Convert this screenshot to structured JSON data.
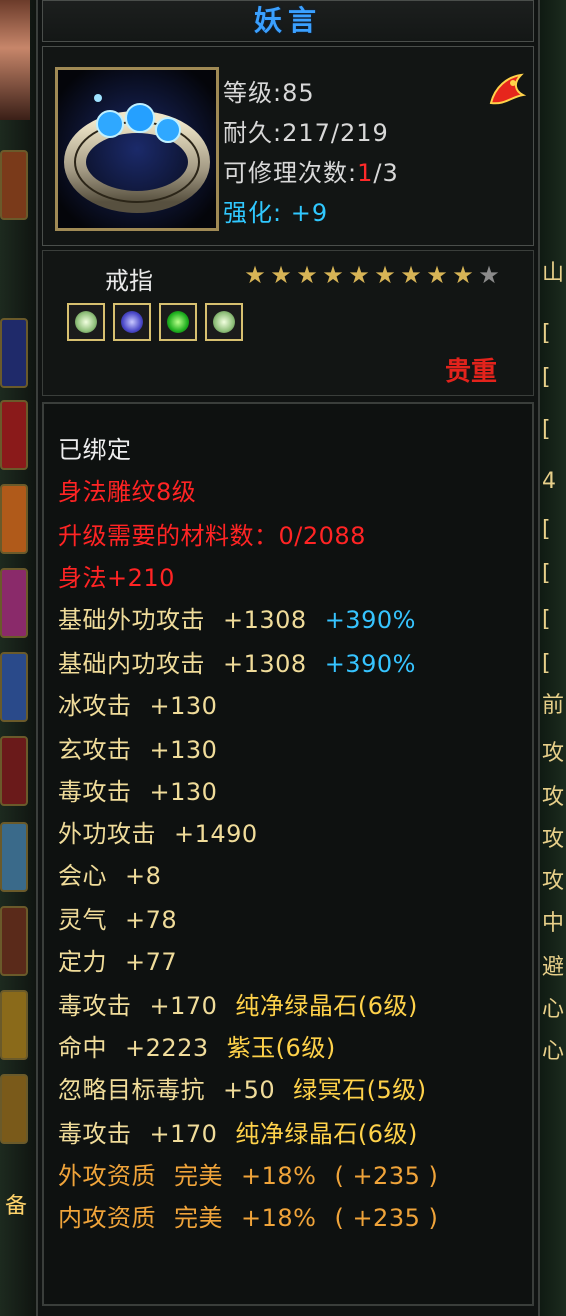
{
  "item": {
    "name": "妖言",
    "level": "等级:85",
    "durability_label": "耐久:",
    "durability_value": "217/219",
    "repairs_label": "可修理次数:",
    "repairs_used": "1",
    "repairs_total": "/3",
    "enhance_label": "强化:",
    "enhance_value": "+9",
    "type": "戒指",
    "stars_filled": 9,
    "stars_total": 10,
    "rarity": "贵重",
    "gems": [
      "white-gem",
      "blue-gem",
      "green-gem",
      "white-gem"
    ],
    "icon": "ring-icon",
    "badge_icon": "dragon-badge-icon"
  },
  "attributes": {
    "bound": "已绑定",
    "carve": "身法雕纹8级",
    "upgrade_materials": "升级需要的材料数：0/2088",
    "shenfa": "身法+210",
    "base_ext_attack": {
      "label": "基础外功攻击",
      "value": "+1308",
      "percent": "+390%"
    },
    "base_int_attack": {
      "label": "基础内功攻击",
      "value": "+1308",
      "percent": "+390%"
    },
    "ice_attack": {
      "label": "冰攻击",
      "value": "+130"
    },
    "mystic_attack": {
      "label": "玄攻击",
      "value": "+130"
    },
    "poison_attack": {
      "label": "毒攻击",
      "value": "+130"
    },
    "ext_attack": {
      "label": "外功攻击",
      "value": "+1490"
    },
    "crit": {
      "label": "会心",
      "value": "+8"
    },
    "spirit": {
      "label": "灵气",
      "value": "+78"
    },
    "resolve": {
      "label": "定力",
      "value": "+77"
    },
    "gem_line_1": {
      "label": "毒攻击",
      "value": "+170",
      "gem": "纯净绿晶石(6级)"
    },
    "gem_line_2": {
      "label": "命中",
      "value": "+2223",
      "gem": "紫玉(6级)"
    },
    "gem_line_3": {
      "label": "忽略目标毒抗",
      "value": "+50",
      "gem": "绿冥石(5级)"
    },
    "gem_line_4": {
      "label": "毒攻击",
      "value": "+170",
      "gem": "纯净绿晶石(6级)"
    },
    "aptitude_ext": {
      "label": "外攻资质",
      "grade": "完美",
      "percent": "+18%",
      "bonus": "( +235 )"
    },
    "aptitude_int": {
      "label": "内攻资质",
      "grade": "完美",
      "percent": "+18%",
      "bonus": "( +235 )"
    }
  },
  "side_glyphs": {
    "left_bottom": "备",
    "right": [
      "山",
      "[",
      "[",
      "[",
      "4",
      "[",
      "[",
      "[",
      "[",
      "前",
      "攻",
      "攻",
      "攻",
      "攻",
      "中",
      "避",
      "心",
      "心"
    ]
  },
  "colors": {
    "title": "#3aa0ff",
    "red": "#ff2424",
    "gold": "#f0dc9a",
    "orange": "#f0a43a",
    "cyan": "#36c4ff",
    "frame": "#3a3e3b"
  }
}
